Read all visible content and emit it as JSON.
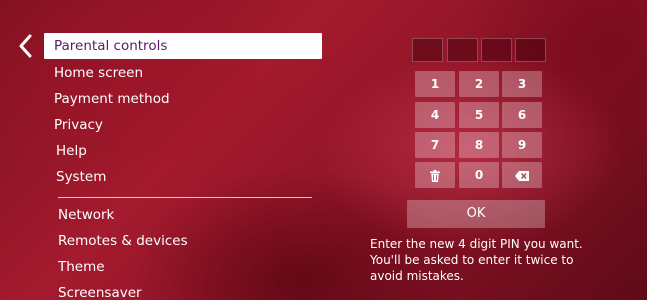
{
  "settings_menu": {
    "back_icon": "chevron-left-icon",
    "items": [
      {
        "label": "Parental controls",
        "selected": true
      },
      {
        "label": "Home screen"
      },
      {
        "label": "Payment method"
      },
      {
        "label": "Privacy"
      },
      {
        "label": "Help"
      },
      {
        "label": "System"
      },
      {
        "label": "Network"
      },
      {
        "label": "Remotes & devices"
      },
      {
        "label": "Theme"
      },
      {
        "label": "Screensaver"
      }
    ]
  },
  "pin_entry": {
    "digits_entered": 0,
    "digit_count": 4,
    "keys": [
      "1",
      "2",
      "3",
      "4",
      "5",
      "6",
      "7",
      "8",
      "9"
    ],
    "zero_key": "0",
    "clear_icon": "trash-icon",
    "backspace_icon": "backspace-icon",
    "ok_label": "OK",
    "instruction_line1": "Enter the new 4 digit PIN you want.",
    "instruction_line2": "You'll be asked to enter it twice to",
    "instruction_line3": "avoid mistakes."
  },
  "colors": {
    "background": "#8e1427",
    "selected_bg": "#ffffff",
    "selected_text": "#5b1a63",
    "key_bg": "rgba(255,255,255,0.28)"
  }
}
